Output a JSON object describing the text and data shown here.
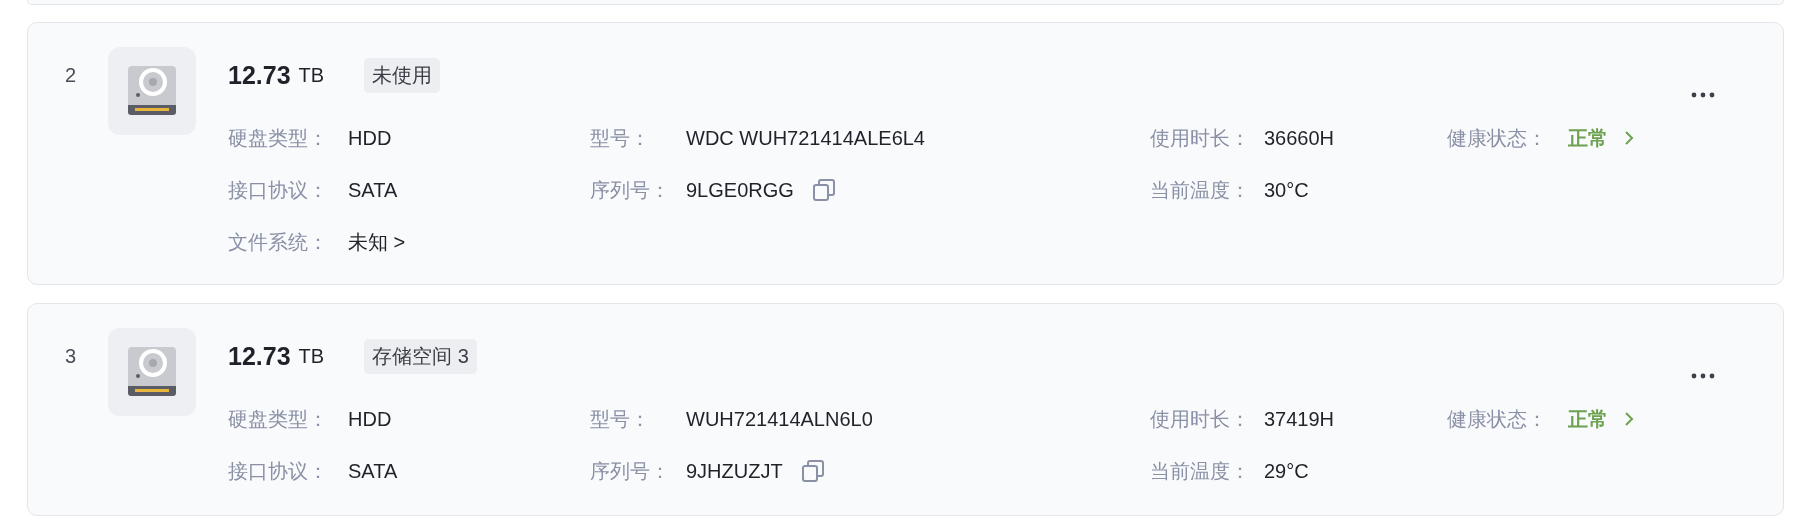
{
  "disks": [
    {
      "index": "2",
      "capacity": "12.73",
      "unit": "TB",
      "tag": "未使用",
      "rows": [
        [
          {
            "label": "硬盘类型：",
            "value": "HDD",
            "kind": "plain"
          },
          {
            "label": "型号：",
            "value": "WDC WUH721414ALE6L4",
            "kind": "plain"
          },
          {
            "label": "使用时长：",
            "value": "36660H",
            "kind": "plain"
          },
          {
            "label": "健康状态：",
            "value": "正常",
            "kind": "health"
          }
        ],
        [
          {
            "label": "接口协议：",
            "value": "SATA",
            "kind": "plain"
          },
          {
            "label": "序列号：",
            "value": "9LGE0RGG",
            "kind": "copy"
          },
          {
            "label": "当前温度：",
            "value": "30°C",
            "kind": "plain"
          }
        ],
        [
          {
            "label": "文件系统：",
            "value": "未知 >",
            "kind": "link"
          }
        ]
      ]
    },
    {
      "index": "3",
      "capacity": "12.73",
      "unit": "TB",
      "tag": "存储空间 3",
      "rows": [
        [
          {
            "label": "硬盘类型：",
            "value": "HDD",
            "kind": "plain"
          },
          {
            "label": "型号：",
            "value": "WUH721414ALN6L0",
            "kind": "plain"
          },
          {
            "label": "使用时长：",
            "value": "37419H",
            "kind": "plain"
          },
          {
            "label": "健康状态：",
            "value": "正常",
            "kind": "health"
          }
        ],
        [
          {
            "label": "接口协议：",
            "value": "SATA",
            "kind": "plain"
          },
          {
            "label": "序列号：",
            "value": "9JHZUZJT",
            "kind": "copy"
          },
          {
            "label": "当前温度：",
            "value": "29°C",
            "kind": "plain"
          }
        ]
      ]
    }
  ]
}
